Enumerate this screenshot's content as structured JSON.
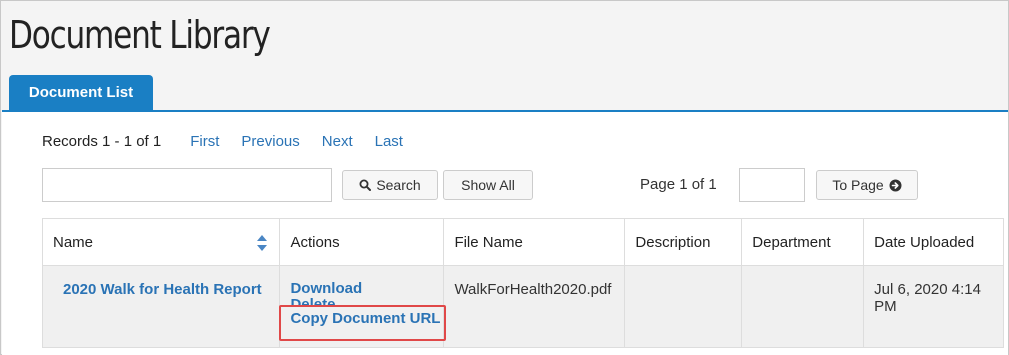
{
  "page": {
    "title": "Document Library"
  },
  "tabs": [
    {
      "label": "Document List",
      "active": true
    }
  ],
  "pager": {
    "records": "Records 1 - 1 of 1",
    "first": "First",
    "previous": "Previous",
    "next": "Next",
    "last": "Last"
  },
  "toolbar": {
    "search_value": "",
    "search_label": "Search",
    "show_all_label": "Show All",
    "page_status": "Page 1 of 1",
    "page_value": "",
    "to_page_label": "To Page"
  },
  "table": {
    "columns": [
      "Name",
      "Actions",
      "File Name",
      "Description",
      "Department",
      "Date Uploaded"
    ],
    "rows": [
      {
        "name": "2020 Walk for Health Report",
        "actions": {
          "download": "Download",
          "delete": "Delete",
          "copy_url": "Copy Document URL"
        },
        "file_name": "WalkForHealth2020.pdf",
        "description": "",
        "department": "",
        "date_uploaded": "Jul 6, 2020 4:14 PM"
      }
    ]
  },
  "colors": {
    "accent": "#1a7fc4",
    "link": "#2a73b5",
    "highlight": "#e04848"
  },
  "icons": {
    "search": "search-icon",
    "to_page": "arrow-circle-right-icon",
    "sort": "sort-icon"
  }
}
